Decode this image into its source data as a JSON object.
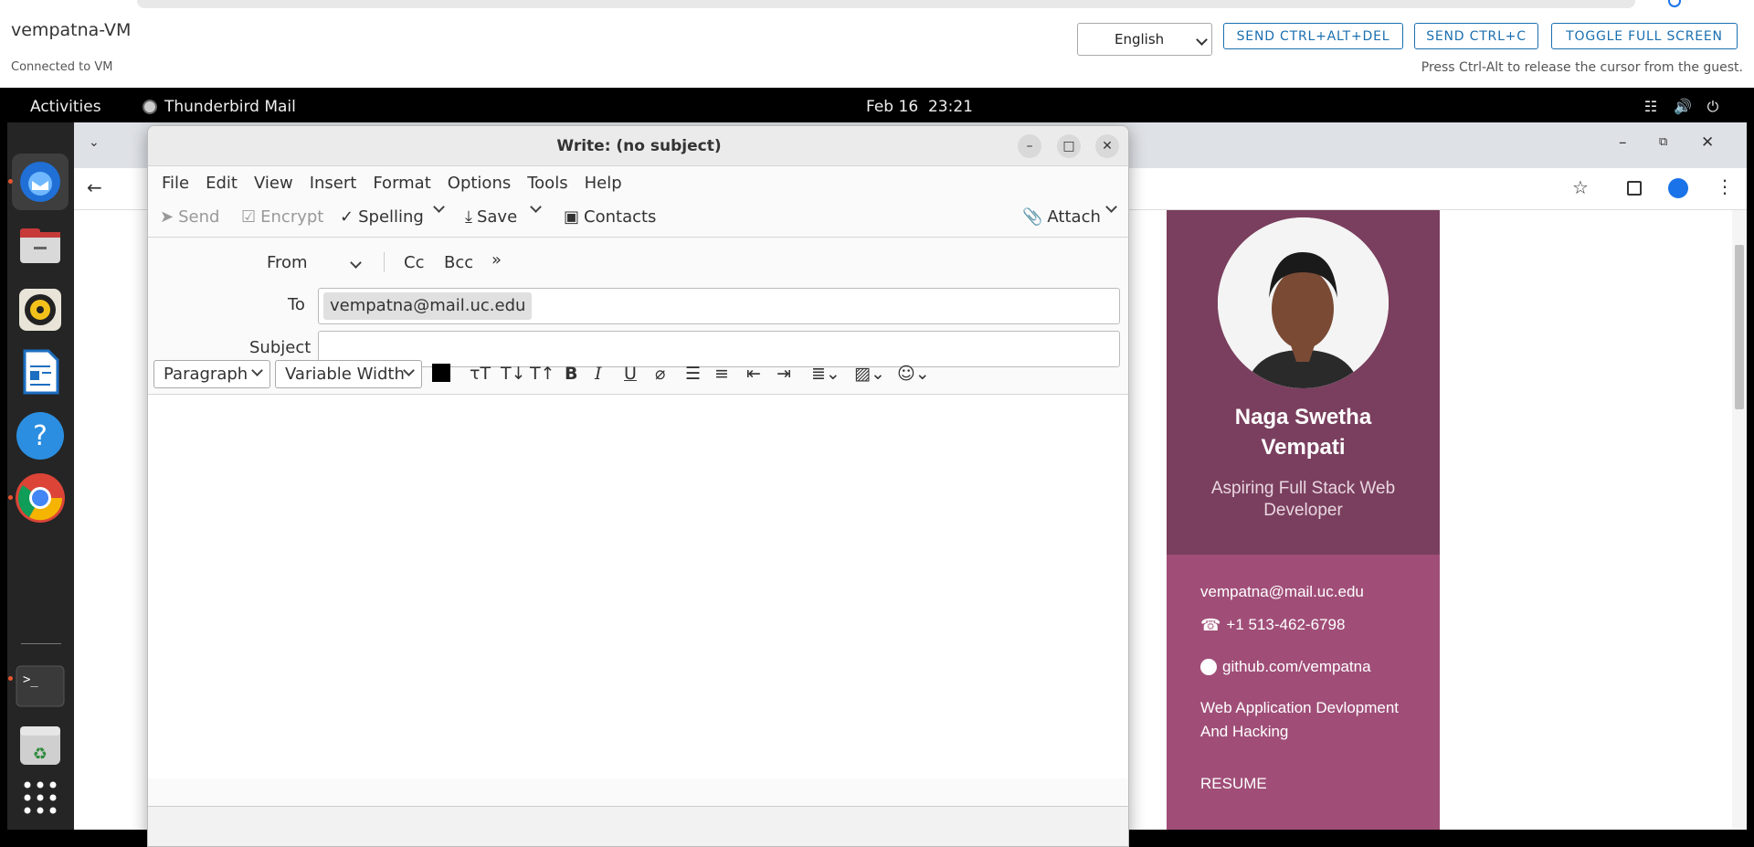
{
  "vm": {
    "name": "vempatna-VM",
    "status": "Connected to VM",
    "hint": "Press Ctrl-Alt to release the cursor from the guest.",
    "language": "English",
    "buttons": {
      "ctrl_alt_del": "SEND CTRL+ALT+DEL",
      "ctrl_c": "SEND CTRL+C",
      "fullscreen": "TOGGLE FULL SCREEN"
    }
  },
  "gnome": {
    "activities": "Activities",
    "app_name": "Thunderbird Mail",
    "date": "Feb 16",
    "time": "23:21"
  },
  "dock": {
    "items": [
      "thunderbird-icon",
      "files-icon",
      "rhythmbox-icon",
      "writer-icon",
      "help-icon",
      "chrome-icon",
      "terminal-icon",
      "trash-icon",
      "app-grid-icon"
    ]
  },
  "compose": {
    "title": "Write: (no subject)",
    "menu": [
      "File",
      "Edit",
      "View",
      "Insert",
      "Format",
      "Options",
      "Tools",
      "Help"
    ],
    "toolbar": {
      "send": "Send",
      "encrypt": "Encrypt",
      "spelling": "Spelling",
      "save": "Save",
      "contacts": "Contacts",
      "attach": "Attach"
    },
    "from_label": "From",
    "cc": "Cc",
    "bcc": "Bcc",
    "to_label": "To",
    "to_value": "vempatna@mail.uc.edu",
    "subject_label": "Subject",
    "subject_value": "",
    "paragraph": "Paragraph",
    "font": "Variable Width"
  },
  "profile": {
    "name_line1": "Naga Swetha",
    "name_line2": "Vempati",
    "role": "Aspiring Full Stack Web Developer",
    "email": "vempatna@mail.uc.edu",
    "phone": "+1 513-462-6798",
    "github": "github.com/vempatna",
    "interest": "Web Application Devlopment And Hacking",
    "resume": "RESUME"
  }
}
